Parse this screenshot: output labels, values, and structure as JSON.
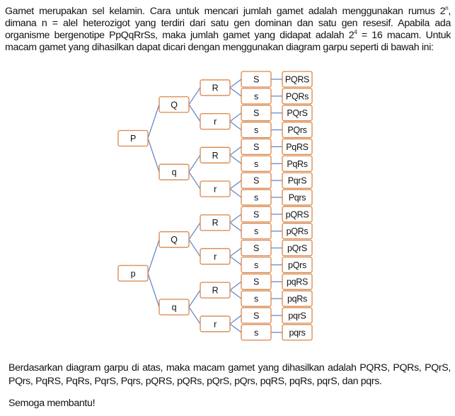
{
  "intro": {
    "line1": "Gamet merupakan sel kelamin. Cara untuk mencari jumlah gamet adalah menggunakan rumus ",
    "base": "2",
    "exp_n": "n",
    "line2": ", dimana n = alel heterozigot yang terdiri dari satu gen dominan dan satu gen resesif. Apabila ada organisme bergenotipe PpQqRrSs, maka jumlah gamet yang didapat adalah ",
    "base2": "2",
    "exp_4": "4",
    "line3": " = 16 macam. Untuk macam gamet yang dihasilkan dapat dicari dengan menggunakan diagram garpu seperti di bawah ini:"
  },
  "diagram": {
    "colors": {
      "box_border": "#d9864a",
      "edge": "#5b7fc7"
    },
    "tree": [
      {
        "label": "P",
        "children": [
          {
            "label": "Q",
            "children": [
              {
                "label": "R",
                "children": [
                  {
                    "label": "S",
                    "result": "PQRS"
                  },
                  {
                    "label": "s",
                    "result": "PQRs"
                  }
                ]
              },
              {
                "label": "r",
                "children": [
                  {
                    "label": "S",
                    "result": "PQrS"
                  },
                  {
                    "label": "s",
                    "result": "PQrs"
                  }
                ]
              }
            ]
          },
          {
            "label": "q",
            "children": [
              {
                "label": "R",
                "children": [
                  {
                    "label": "S",
                    "result": "PqRS"
                  },
                  {
                    "label": "s",
                    "result": "PqRs"
                  }
                ]
              },
              {
                "label": "r",
                "children": [
                  {
                    "label": "S",
                    "result": "PqrS"
                  },
                  {
                    "label": "s",
                    "result": "Pqrs"
                  }
                ]
              }
            ]
          }
        ]
      },
      {
        "label": "p",
        "children": [
          {
            "label": "Q",
            "children": [
              {
                "label": "R",
                "children": [
                  {
                    "label": "S",
                    "result": "pQRS"
                  },
                  {
                    "label": "s",
                    "result": "pQRs"
                  }
                ]
              },
              {
                "label": "r",
                "children": [
                  {
                    "label": "S",
                    "result": "pQrS"
                  },
                  {
                    "label": "s",
                    "result": "pQrs"
                  }
                ]
              }
            ]
          },
          {
            "label": "q",
            "children": [
              {
                "label": "R",
                "children": [
                  {
                    "label": "S",
                    "result": "pqRS"
                  },
                  {
                    "label": "s",
                    "result": "pqRs"
                  }
                ]
              },
              {
                "label": "r",
                "children": [
                  {
                    "label": "S",
                    "result": "pqrS"
                  },
                  {
                    "label": "s",
                    "result": "pqrs"
                  }
                ]
              }
            ]
          }
        ]
      }
    ]
  },
  "conclusion": "Berdasarkan diagram garpu di atas, maka macam gamet yang dihasilkan adalah PQRS, PQRs, PQrS, PQrs, PqRS, PqRs, PqrS, Pqrs, pQRS, pQRs, pQrS, pQrs, pqRS, pqRs, pqrS, dan pqrs.",
  "closing": "Semoga membantu!"
}
